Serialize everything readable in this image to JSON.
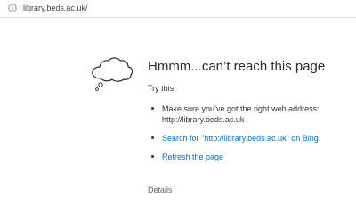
{
  "browser": {
    "address_bar": {
      "url": "library.beds.ac.uk/",
      "icon": "info-icon"
    }
  },
  "error": {
    "icon": "thought-cloud-icon",
    "title": "Hmmm...can’t reach this page",
    "try_this_label": "Try this",
    "suggestions": [
      {
        "text": "Make sure you’ve got the right web address: http://library.beds.ac.uk",
        "type": "text"
      },
      {
        "text": "Search for \"http://library.beds.ac.uk\" on Bing",
        "type": "link"
      },
      {
        "text": "Refresh the page",
        "type": "link"
      }
    ],
    "details_label": "Details"
  },
  "colors": {
    "link": "#0a6fc2",
    "text": "#2b2b2b",
    "muted": "#666666"
  }
}
